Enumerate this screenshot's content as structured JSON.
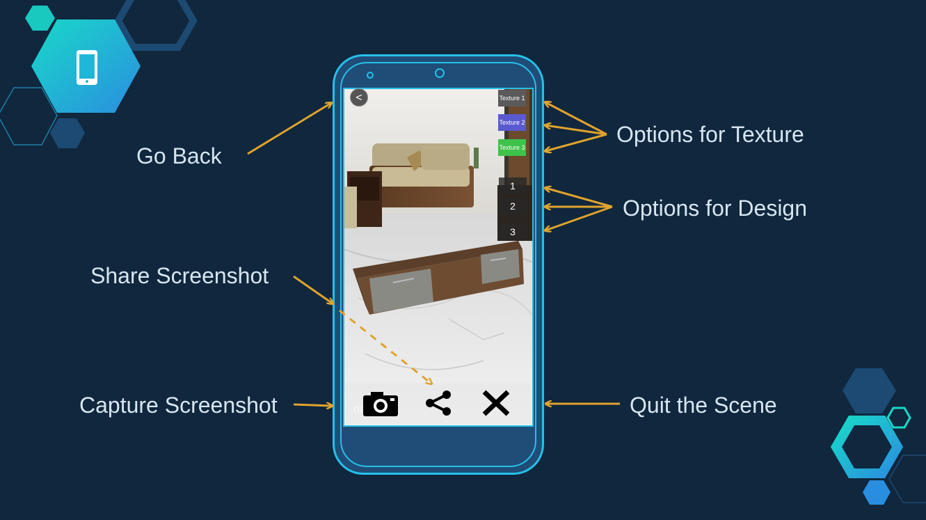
{
  "annotations": {
    "go_back": "Go Back",
    "options_texture": "Options for Texture",
    "options_design": "Options for Design",
    "share_screenshot": "Share Screenshot",
    "capture_screenshot": "Capture Screenshot",
    "quit_scene": "Quit the Scene"
  },
  "app": {
    "back_label": "<",
    "texture_buttons": [
      {
        "label": "Texture 1",
        "color": "#5a5a5a"
      },
      {
        "label": "Texture 2",
        "color": "#5a5ad0"
      },
      {
        "label": "Texture 3",
        "color": "#3ec24a"
      }
    ],
    "design_buttons": [
      "1",
      "2",
      "3"
    ],
    "watermark": "ria",
    "bottom_icons": [
      "camera-icon",
      "share-icon",
      "close-icon"
    ]
  },
  "colors": {
    "background": "#10273d",
    "phone_body": "#1f4d78",
    "phone_outline": "#27c0e8",
    "arrow": "#e0a32e",
    "label_text": "#d6e6f2"
  }
}
